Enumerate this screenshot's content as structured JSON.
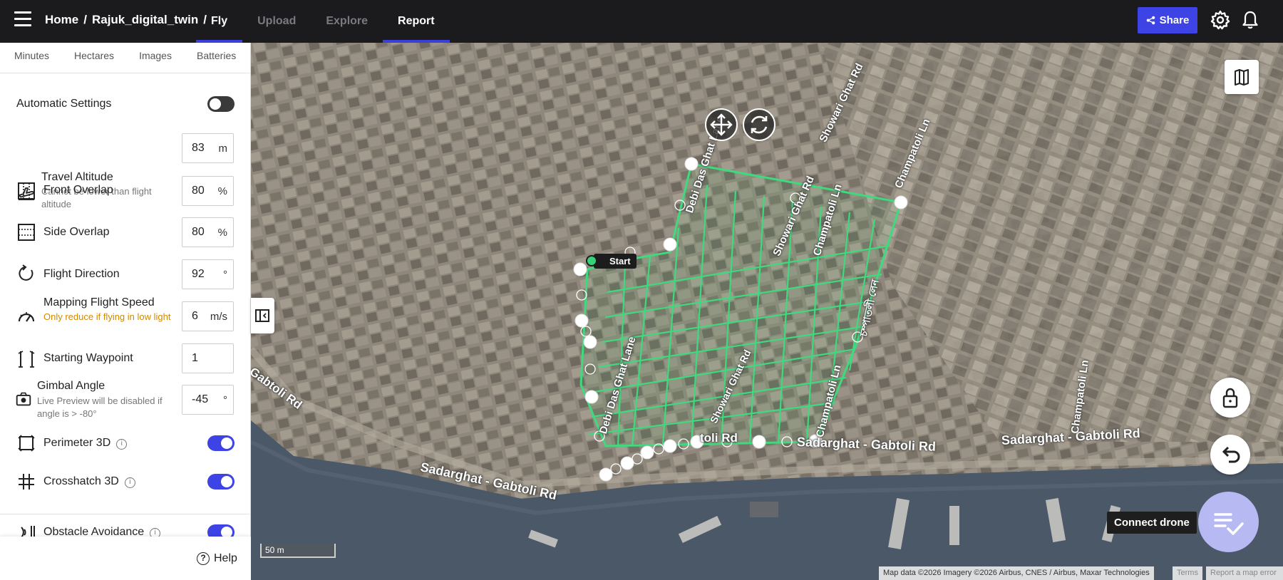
{
  "breadcrumb": {
    "home": "Home",
    "sep1": "/",
    "project": "Rajuk_digital_twin",
    "sep2": "/"
  },
  "tabs": [
    {
      "label": "Fly",
      "active": true
    },
    {
      "label": "Upload",
      "active": false
    },
    {
      "label": "Explore",
      "active": false
    },
    {
      "label": "Report",
      "active": false
    }
  ],
  "share_label": "Share",
  "stats": [
    "Minutes",
    "Hectares",
    "Images",
    "Batteries"
  ],
  "settings": {
    "automatic": {
      "label": "Automatic Settings",
      "enabled": false
    },
    "travel_altitude": {
      "label": "Travel Altitude",
      "sub": "Cannot be lower than flight altitude",
      "value": "83",
      "unit": "m"
    },
    "front_overlap": {
      "label": "Front Overlap",
      "value": "80",
      "unit": "%"
    },
    "side_overlap": {
      "label": "Side Overlap",
      "value": "80",
      "unit": "%"
    },
    "flight_direction": {
      "label": "Flight Direction",
      "value": "92",
      "unit": "°"
    },
    "speed": {
      "label": "Mapping Flight Speed",
      "sub": "Only reduce if flying in low light",
      "value": "6",
      "unit": "m/s"
    },
    "starting_waypoint": {
      "label": "Starting Waypoint",
      "value": "1"
    },
    "gimbal": {
      "label": "Gimbal Angle",
      "sub": "Live Preview will be disabled if angle is > -80°",
      "value": "-45",
      "unit": "°"
    },
    "perimeter": {
      "label": "Perimeter 3D",
      "enabled": true
    },
    "crosshatch": {
      "label": "Crosshatch 3D",
      "enabled": true
    },
    "obstacle": {
      "label": "Obstacle Avoidance",
      "enabled": true
    }
  },
  "help_label": "Help",
  "map": {
    "start_label": "Start",
    "connect_drone_tooltip": "Connect drone",
    "scale": "50 m",
    "attribution": "Map data ©2026 Imagery ©2026 Airbus, CNES / Airbus, Maxar Technologies",
    "terms": "Terms",
    "report_error": "Report a map error",
    "roads": {
      "sadarghat_1": "Sadarghat - Gabtoli Rd",
      "sadarghat_2": "Sadarghat - Gabtoli Rd",
      "sadarghat_3": "Sadarghat - Gabtoli Rd",
      "gabtoli": "Gabtoli Rd",
      "debi_1": "Debi Das Ghat Lane",
      "debi_2": "Debi Das Ghat Lane",
      "showari_1": "Showari Ghat Rd",
      "showari_2": "Showari Ghat Rd",
      "showari_3": "Showari Ghat Rd",
      "champatoli_1": "Champatoli Ln",
      "champatoli_2": "Champatoli Ln",
      "champatoli_3": "Champatoli Ln",
      "champatoli_4": "Champatoli Ln",
      "bengali": "চম্পাতলী লেন",
      "gabtoli_partial": "toli Rd"
    }
  },
  "colors": {
    "accent": "#3e43e6",
    "flight_path": "#3fd97e",
    "topbar": "#1b1b1e"
  }
}
